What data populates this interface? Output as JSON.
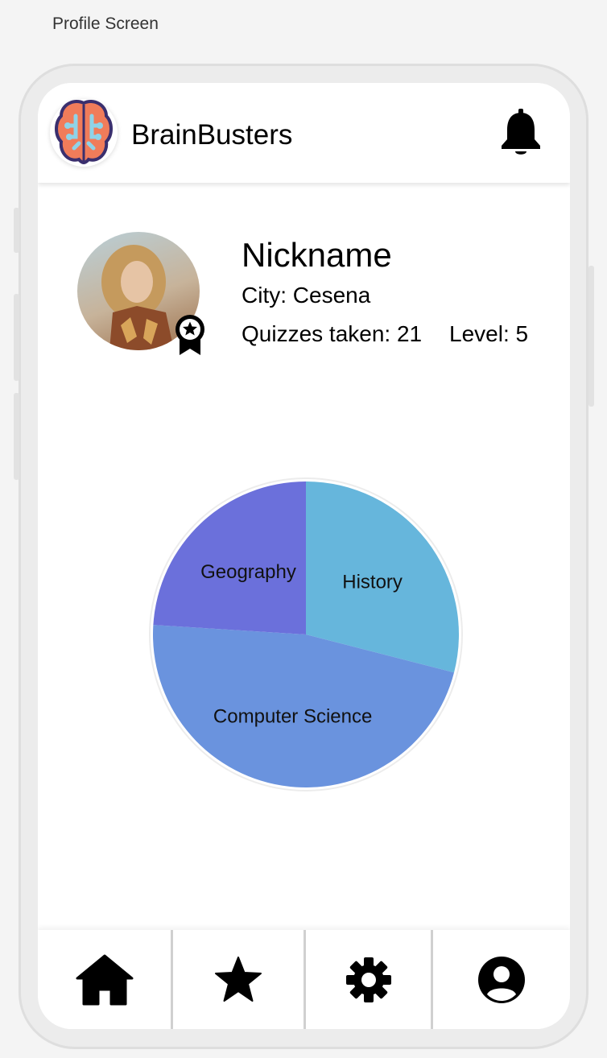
{
  "frame_label": "Profile Screen",
  "header": {
    "app_name": "BrainBusters",
    "logo_icon": "brain-icon",
    "notification_icon": "bell-icon"
  },
  "profile": {
    "nickname": "Nickname",
    "city": "City: Cesena",
    "quizzes_taken": "Quizzes taken: 21",
    "level": "Level: 5",
    "badge_icon": "award-ribbon-icon"
  },
  "chart_data": {
    "type": "pie",
    "title": "",
    "slices": [
      {
        "label": "History",
        "value": 29,
        "color": "#66b6dc"
      },
      {
        "label": "Computer Science",
        "value": 47,
        "color": "#6a93de"
      },
      {
        "label": "Geography",
        "value": 24,
        "color": "#6b70db"
      }
    ]
  },
  "bottom_nav": [
    {
      "icon": "home-icon",
      "label": "Home"
    },
    {
      "icon": "star-icon",
      "label": "Favorites"
    },
    {
      "icon": "gear-icon",
      "label": "Settings"
    },
    {
      "icon": "profile-icon",
      "label": "Profile"
    }
  ]
}
